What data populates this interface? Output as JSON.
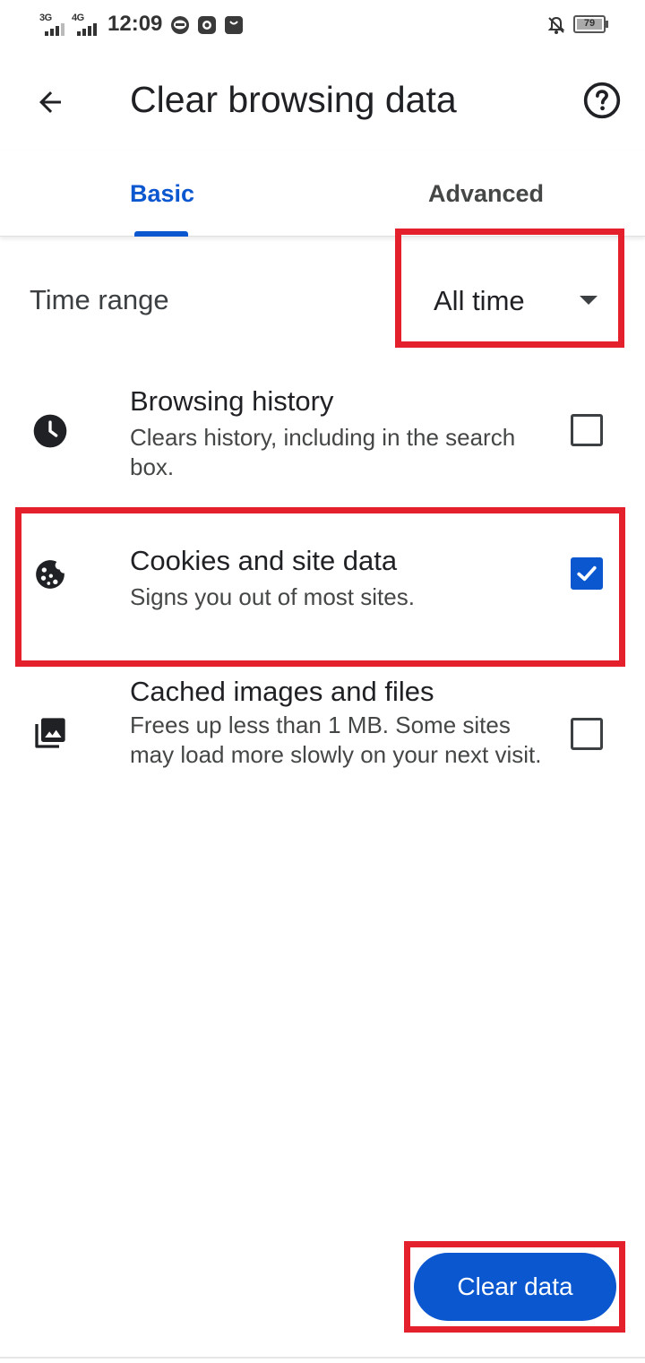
{
  "status_bar": {
    "network_1": "3G",
    "network_2": "4G",
    "time": "12:09",
    "battery": "79",
    "icons": [
      "line-app-icon",
      "camera-app-icon",
      "shopping-bag-icon",
      "notifications-off-icon",
      "battery-icon"
    ]
  },
  "toolbar": {
    "title": "Clear browsing data",
    "back_icon": "arrow-back-icon",
    "help_icon": "help-circle-icon"
  },
  "tabs": [
    {
      "label": "Basic",
      "selected": true
    },
    {
      "label": "Advanced",
      "selected": false
    }
  ],
  "time_range": {
    "label": "Time range",
    "value": "All time"
  },
  "options": [
    {
      "icon": "clock-icon",
      "title": "Browsing history",
      "description": "Clears history, including in the search box.",
      "checked": false
    },
    {
      "icon": "cookie-icon",
      "title": "Cookies and site data",
      "description": "Signs you out of most sites.",
      "checked": true
    },
    {
      "icon": "image-library-icon",
      "title": "Cached images and files",
      "description": "Frees up less than 1 MB. Some sites may load more slowly on your next visit.",
      "checked": false
    }
  ],
  "actions": {
    "clear_label": "Clear data"
  },
  "colors": {
    "accent": "#0b57d0",
    "highlight": "#e4202d",
    "text_primary": "#202124",
    "text_secondary": "#444746"
  }
}
